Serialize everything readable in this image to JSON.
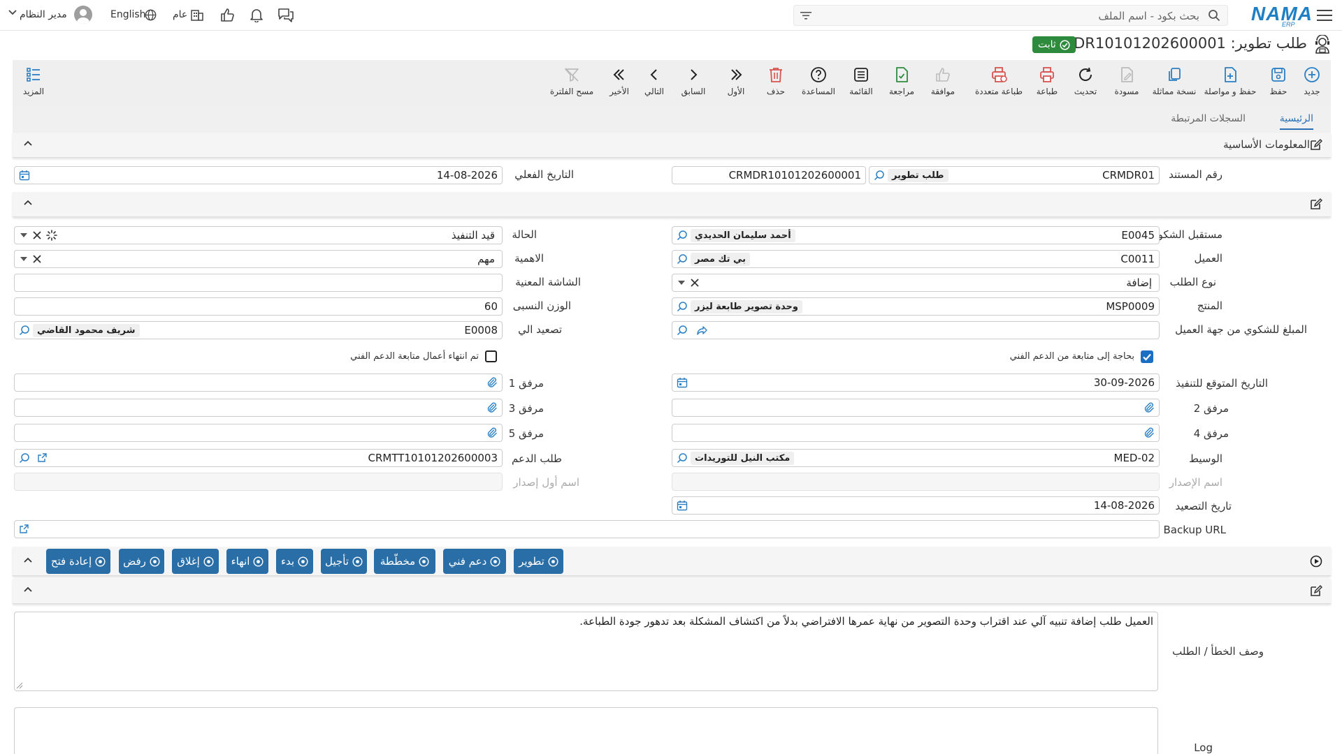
{
  "topbar": {
    "search_placeholder": "بحث بكود - اسم الملف",
    "logo_text": "NAMA",
    "logo_sub": "ERP",
    "user_name": "مدير النظام",
    "language": "English",
    "scope": "عام"
  },
  "title": {
    "text": "طلب تطوير: CRMDR10101202600001",
    "status": "ثابت"
  },
  "toolbar": {
    "new": "جديد",
    "save": "حفظ",
    "save_continue": "حفظ و مواصلة",
    "copy": "نسخة مماثلة",
    "draft": "مسودة",
    "refresh": "تحديث",
    "print": "طباعة",
    "multi_print": "طباعة متعددة",
    "approve": "موافقة",
    "review": "مراجعة",
    "list": "القائمة",
    "help": "المساعدة",
    "delete": "حذف",
    "first": "الأول",
    "previous": "السابق",
    "next": "التالي",
    "last": "الأخير",
    "clear_filter": "مسح الفلترة",
    "more": "المزيد"
  },
  "tabs": {
    "main": "الرئيسية",
    "related": "السجلات المرتبطة"
  },
  "basic_section": {
    "title": "المعلومات الأساسية"
  },
  "fields": {
    "doc_number_label": "رقم المستند",
    "doc_type_code": "CRMDR01",
    "doc_type_name": "طلب تطوير",
    "doc_number_value": "CRMDR10101202600001",
    "actual_date_label": "التاريخ الفعلي",
    "actual_date": "14-08-2026",
    "receiver_label": "مستقبل الشكوي",
    "receiver_code": "E0045",
    "receiver_name": "أحمد سليمان الحديدي",
    "status_label": "الحالة",
    "status_value": "قيد التنفيذ",
    "customer_label": "العميل",
    "customer_code": "C0011",
    "customer_name": "بي تك مصر",
    "priority_label": "الاهمية",
    "priority_value": "مهم",
    "request_type_label": "نوع الطلب",
    "request_type_value": "إضافة",
    "screen_label": "الشاشة المعنية",
    "screen_value": "",
    "product_label": "المنتج",
    "product_code": "MSP0009",
    "product_name": "وحدة تصوير طابعة ليزر",
    "weight_label": "الوزن النسبى",
    "weight_value": "60",
    "reporter_label": "المبلغ للشكوي من جهة العميل",
    "reporter_value": "",
    "escalate_label": "تصعيد الي",
    "escalate_code": "E0008",
    "escalate_name": "شريف محمود القاضي",
    "needs_followup_label": "بحاجة إلى متابعة من الدعم الفني",
    "needs_followup": true,
    "followup_done_label": "تم انتهاء أعمال متابعة الدعم الفني",
    "followup_done": false,
    "expected_date_label": "التاريخ المتوقع للتنفيذ",
    "expected_date": "30-09-2026",
    "att1_label": "مرفق 1",
    "att2_label": "مرفق 2",
    "att3_label": "مرفق 3",
    "att4_label": "مرفق 4",
    "att5_label": "مرفق 5",
    "broker_label": "الوسيط",
    "broker_code": "MED-02",
    "broker_name": "مكتب النيل للتوريدات",
    "support_req_label": "طلب الدعم",
    "support_req_value": "CRMTT10101202600003",
    "release_name_label": "اسم الإصدار",
    "first_release_label": "اسم أول إصدار",
    "escalation_date_label": "تاريخ التصعيد",
    "escalation_date": "14-08-2026",
    "backup_url_label": "Backup URL",
    "desc_label": "وصف الخطأ / الطلب",
    "desc_value": "العميل طلب إضافة تنبيه آلي عند اقتراب وحدة التصوير من نهاية عمرها الافتراضي بدلاً من اكتشاف المشكلة بعد تدهور جودة الطباعة.",
    "log_label": "Log"
  },
  "actions": {
    "develop": "تطوير",
    "support": "دعم فني",
    "planned": "مخطّطة",
    "postpone": "تأجيل",
    "start": "بدء",
    "finish": "انهاء",
    "close": "إغلاق",
    "reject": "رفض",
    "reopen": "إعادة فتح"
  },
  "colors": {
    "accent": "#2a6ea8",
    "status_green": "#2e8b3e",
    "print_red": "#d9534f",
    "logo_blue": "#1f7fc4"
  }
}
